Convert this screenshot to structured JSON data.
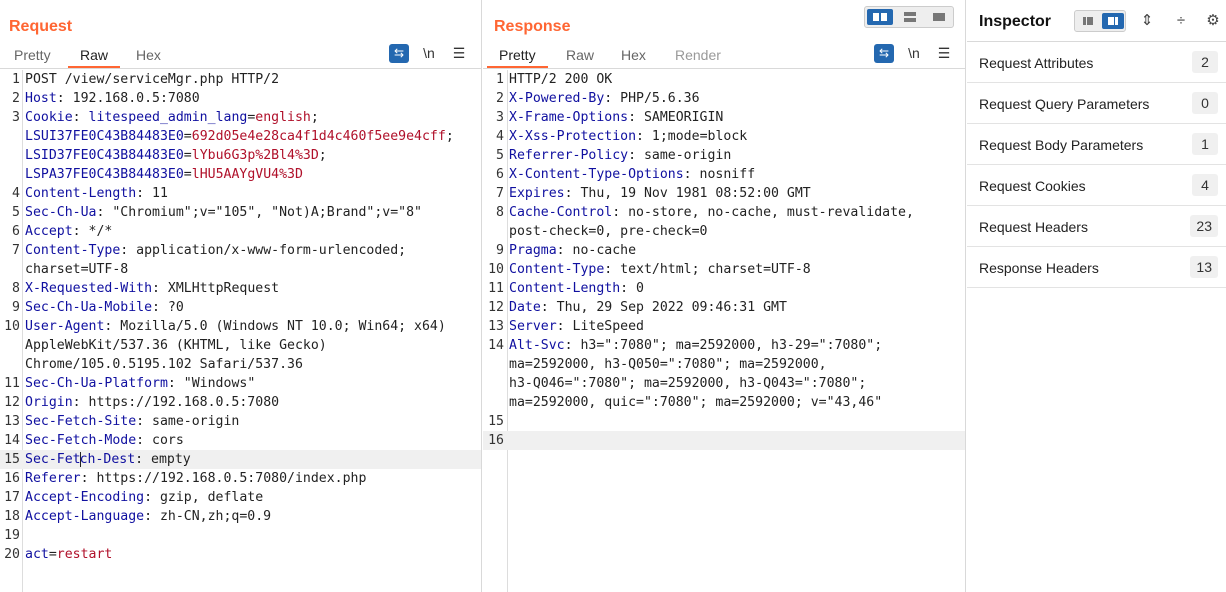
{
  "request": {
    "title": "Request",
    "tabs": [
      "Pretty",
      "Raw",
      "Hex"
    ],
    "active_tab": "Raw",
    "tools": {
      "wrap_icon": "wrap-icon",
      "newline_label": "\\n",
      "menu_icon": "menu-icon"
    },
    "lines": [
      {
        "n": "1",
        "parts": [
          [
            "",
            "POST /view/serviceMgr.php HTTP/2"
          ]
        ]
      },
      {
        "n": "2",
        "parts": [
          [
            "k",
            "Host"
          ],
          [
            "",
            ": 192.168.0.5:7080"
          ]
        ]
      },
      {
        "n": "3",
        "parts": [
          [
            "k",
            "Cookie"
          ],
          [
            "",
            ": "
          ],
          [
            "ck",
            "litespeed_admin_lang"
          ],
          [
            "",
            "="
          ],
          [
            "cv",
            "english"
          ],
          [
            "",
            ";"
          ]
        ]
      },
      {
        "n": "",
        "parts": [
          [
            "ck",
            "LSUI37FE0C43B84483E0"
          ],
          [
            "",
            "="
          ],
          [
            "cv",
            "692d05e4e28ca4f1d4c460f5ee9e4cff"
          ],
          [
            "",
            ";"
          ]
        ]
      },
      {
        "n": "",
        "parts": [
          [
            "ck",
            "LSID37FE0C43B84483E0"
          ],
          [
            "",
            "="
          ],
          [
            "cv",
            "lYbu6G3p%2Bl4%3D"
          ],
          [
            "",
            ";"
          ]
        ]
      },
      {
        "n": "",
        "parts": [
          [
            "ck",
            "LSPA37FE0C43B84483E0"
          ],
          [
            "",
            "="
          ],
          [
            "cv",
            "lHU5AAYgVU4%3D"
          ]
        ]
      },
      {
        "n": "4",
        "parts": [
          [
            "k",
            "Content-Length"
          ],
          [
            "",
            ": 11"
          ]
        ]
      },
      {
        "n": "5",
        "parts": [
          [
            "k",
            "Sec-Ch-Ua"
          ],
          [
            "",
            ": \"Chromium\";v=\"105\", \"Not)A;Brand\";v=\"8\""
          ]
        ]
      },
      {
        "n": "6",
        "parts": [
          [
            "k",
            "Accept"
          ],
          [
            "",
            ": */*"
          ]
        ]
      },
      {
        "n": "7",
        "parts": [
          [
            "k",
            "Content-Type"
          ],
          [
            "",
            ": application/x-www-form-urlencoded;"
          ]
        ]
      },
      {
        "n": "",
        "parts": [
          [
            "",
            "charset=UTF-8"
          ]
        ]
      },
      {
        "n": "8",
        "parts": [
          [
            "k",
            "X-Requested-With"
          ],
          [
            "",
            ": XMLHttpRequest"
          ]
        ]
      },
      {
        "n": "9",
        "parts": [
          [
            "k",
            "Sec-Ch-Ua-Mobile"
          ],
          [
            "",
            ": ?0"
          ]
        ]
      },
      {
        "n": "10",
        "parts": [
          [
            "k",
            "User-Agent"
          ],
          [
            "",
            ": Mozilla/5.0 (Windows NT 10.0; Win64; x64)"
          ]
        ]
      },
      {
        "n": "",
        "parts": [
          [
            "",
            "AppleWebKit/537.36 (KHTML, like Gecko)"
          ]
        ]
      },
      {
        "n": "",
        "parts": [
          [
            "",
            "Chrome/105.0.5195.102 Safari/537.36"
          ]
        ]
      },
      {
        "n": "11",
        "parts": [
          [
            "k",
            "Sec-Ch-Ua-Platform"
          ],
          [
            "",
            ": \"Windows\""
          ]
        ]
      },
      {
        "n": "12",
        "parts": [
          [
            "k",
            "Origin"
          ],
          [
            "",
            ": https://192.168.0.5:7080"
          ]
        ]
      },
      {
        "n": "13",
        "parts": [
          [
            "k",
            "Sec-Fetch-Site"
          ],
          [
            "",
            ": same-origin"
          ]
        ]
      },
      {
        "n": "14",
        "parts": [
          [
            "k",
            "Sec-Fetch-Mode"
          ],
          [
            "",
            ": cors"
          ]
        ]
      },
      {
        "n": "15",
        "hl": true,
        "caret_after": "Sec-Fet",
        "parts": [
          [
            "k",
            "Sec-Fetch-Dest"
          ],
          [
            "",
            ": empty"
          ]
        ]
      },
      {
        "n": "16",
        "parts": [
          [
            "k",
            "Referer"
          ],
          [
            "",
            ": https://192.168.0.5:7080/index.php"
          ]
        ]
      },
      {
        "n": "17",
        "parts": [
          [
            "k",
            "Accept-Encoding"
          ],
          [
            "",
            ": gzip, deflate"
          ]
        ]
      },
      {
        "n": "18",
        "parts": [
          [
            "k",
            "Accept-Language"
          ],
          [
            "",
            ": zh-CN,zh;q=0.9"
          ]
        ]
      },
      {
        "n": "19",
        "parts": [
          [
            "",
            ""
          ]
        ]
      },
      {
        "n": "20",
        "parts": [
          [
            "ck",
            "act"
          ],
          [
            "",
            "="
          ],
          [
            "cv",
            "restart"
          ]
        ]
      }
    ]
  },
  "response": {
    "title": "Response",
    "tabs": [
      "Pretty",
      "Raw",
      "Hex",
      "Render"
    ],
    "active_tab": "Pretty",
    "tools": {
      "wrap_icon": "wrap-icon",
      "newline_label": "\\n",
      "menu_icon": "menu-icon"
    },
    "lines": [
      {
        "n": "1",
        "parts": [
          [
            "",
            "HTTP/2 200 OK"
          ]
        ]
      },
      {
        "n": "2",
        "parts": [
          [
            "k",
            "X-Powered-By"
          ],
          [
            "",
            ": PHP/5.6.36"
          ]
        ]
      },
      {
        "n": "3",
        "parts": [
          [
            "k",
            "X-Frame-Options"
          ],
          [
            "",
            ": SAMEORIGIN"
          ]
        ]
      },
      {
        "n": "4",
        "parts": [
          [
            "k",
            "X-Xss-Protection"
          ],
          [
            "",
            ": 1;mode=block"
          ]
        ]
      },
      {
        "n": "5",
        "parts": [
          [
            "k",
            "Referrer-Policy"
          ],
          [
            "",
            ": same-origin"
          ]
        ]
      },
      {
        "n": "6",
        "parts": [
          [
            "k",
            "X-Content-Type-Options"
          ],
          [
            "",
            ": nosniff"
          ]
        ]
      },
      {
        "n": "7",
        "parts": [
          [
            "k",
            "Expires"
          ],
          [
            "",
            ": Thu, 19 Nov 1981 08:52:00 GMT"
          ]
        ]
      },
      {
        "n": "8",
        "parts": [
          [
            "k",
            "Cache-Control"
          ],
          [
            "",
            ": no-store, no-cache, must-revalidate,"
          ]
        ]
      },
      {
        "n": "",
        "parts": [
          [
            "",
            "post-check=0, pre-check=0"
          ]
        ]
      },
      {
        "n": "9",
        "parts": [
          [
            "k",
            "Pragma"
          ],
          [
            "",
            ": no-cache"
          ]
        ]
      },
      {
        "n": "10",
        "parts": [
          [
            "k",
            "Content-Type"
          ],
          [
            "",
            ": text/html; charset=UTF-8"
          ]
        ]
      },
      {
        "n": "11",
        "parts": [
          [
            "k",
            "Content-Length"
          ],
          [
            "",
            ": 0"
          ]
        ]
      },
      {
        "n": "12",
        "parts": [
          [
            "k",
            "Date"
          ],
          [
            "",
            ": Thu, 29 Sep 2022 09:46:31 GMT"
          ]
        ]
      },
      {
        "n": "13",
        "parts": [
          [
            "k",
            "Server"
          ],
          [
            "",
            ": LiteSpeed"
          ]
        ]
      },
      {
        "n": "14",
        "parts": [
          [
            "k",
            "Alt-Svc"
          ],
          [
            "",
            ": h3=\":7080\"; ma=2592000, h3-29=\":7080\";"
          ]
        ]
      },
      {
        "n": "",
        "parts": [
          [
            "",
            "ma=2592000, h3-Q050=\":7080\"; ma=2592000,"
          ]
        ]
      },
      {
        "n": "",
        "parts": [
          [
            "",
            "h3-Q046=\":7080\"; ma=2592000, h3-Q043=\":7080\";"
          ]
        ]
      },
      {
        "n": "",
        "parts": [
          [
            "",
            "ma=2592000, quic=\":7080\"; ma=2592000; v=\"43,46\""
          ]
        ]
      },
      {
        "n": "15",
        "parts": [
          [
            "",
            ""
          ]
        ]
      },
      {
        "n": "16",
        "hl": true,
        "parts": [
          [
            "",
            ""
          ]
        ]
      }
    ]
  },
  "inspector": {
    "title": "Inspector",
    "rows": [
      {
        "label": "Request Attributes",
        "count": "2"
      },
      {
        "label": "Request Query Parameters",
        "count": "0"
      },
      {
        "label": "Request Body Parameters",
        "count": "1"
      },
      {
        "label": "Request Cookies",
        "count": "4"
      },
      {
        "label": "Request Headers",
        "count": "23"
      },
      {
        "label": "Response Headers",
        "count": "13"
      }
    ]
  },
  "colors": {
    "accent": "#ff6633",
    "blue": "#2468b0",
    "key": "#1010a0",
    "cookie_value": "#b0102a"
  }
}
